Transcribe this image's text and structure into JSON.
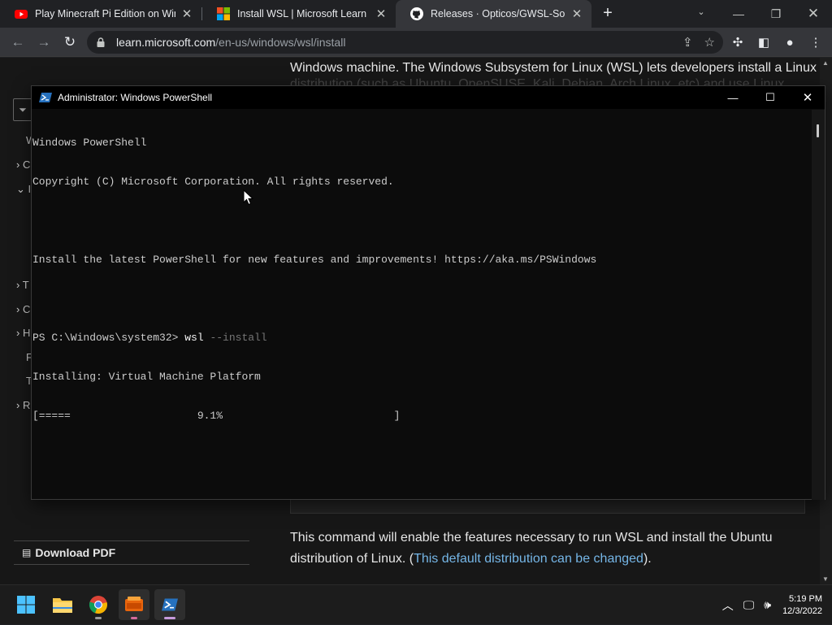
{
  "browser": {
    "tabs": [
      {
        "title": "Play Minecraft Pi Edition on Windows",
        "active": false,
        "icon": "youtube-icon"
      },
      {
        "title": "Install WSL | Microsoft Learn",
        "active": false,
        "icon": "microsoft-icon"
      },
      {
        "title": "Releases · Opticos/GWSL-Source",
        "active": true,
        "icon": "github-icon"
      }
    ],
    "url_host": "learn.microsoft.com",
    "url_path": "/en-us/windows/wsl/install"
  },
  "page": {
    "top_text": "Windows machine. The Windows Subsystem for Linux (WSL) lets developers install a Linux",
    "top_text2": "distribution (such as Ubuntu, OpenSUSE, Kali, Debian, Arch Linux, etc) and use Linux",
    "sidebar_letters": [
      "W",
      "C",
      "I",
      "T",
      "C",
      "H",
      "F",
      "T",
      "R"
    ],
    "download_pdf": "Download PDF",
    "para_before_link": "This command will enable the features necessary to run WSL and install the Ubuntu distribution of Linux. (",
    "para_link": "This default distribution can be changed",
    "para_after_link": ")."
  },
  "powershell": {
    "title": "Administrator: Windows PowerShell",
    "lines": {
      "l1": "Windows PowerShell",
      "l2": "Copyright (C) Microsoft Corporation. All rights reserved.",
      "l3": "Install the latest PowerShell for new features and improvements! https://aka.ms/PSWindows",
      "prompt": "PS C:\\Windows\\system32> ",
      "cmd": "wsl",
      "param": " --install",
      "l5": "Installing: Virtual Machine Platform",
      "l6": "[=====                    9.1%                           ]"
    }
  },
  "taskbar": {
    "time": "5:19 PM",
    "date": "12/3/2022"
  }
}
